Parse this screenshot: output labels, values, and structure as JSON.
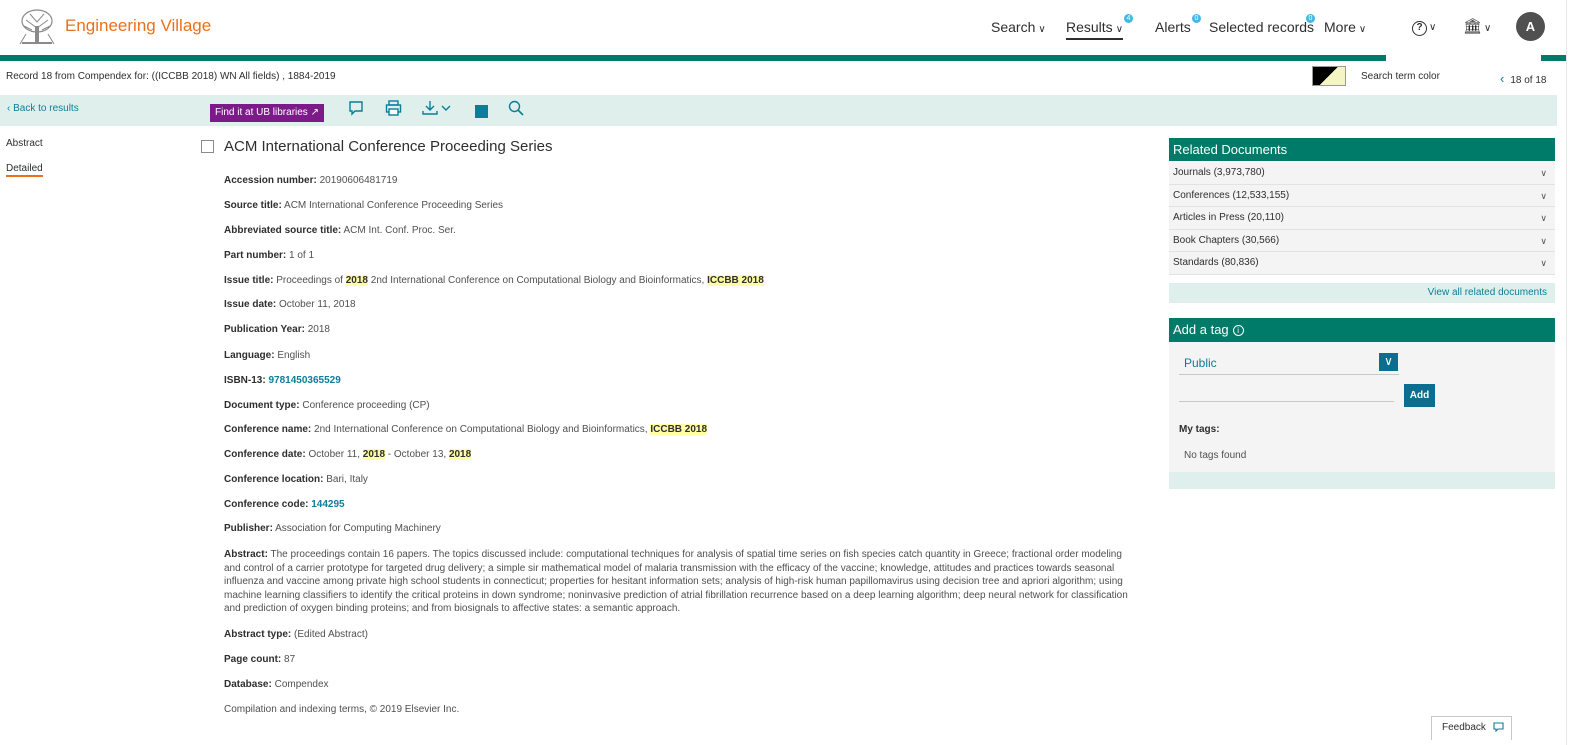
{
  "app": {
    "title": "Engineering Village"
  },
  "nav": {
    "search": "Search",
    "results": "Results",
    "results_badge": "4",
    "alerts": "Alerts",
    "alerts_badge": "0",
    "selected_records": "Selected records",
    "selected_badge": "0",
    "more": "More",
    "chevron": "∨",
    "help_icon": "?",
    "institution_icon": "🏛",
    "avatar": "A"
  },
  "subheader": {
    "record_info": "Record 18 from Compendex for: ((ICCBB 2018) WN All fields) , 1884-2019",
    "search_term_color": "Search term color",
    "pager": "18 of 18",
    "prev_icon": "‹"
  },
  "toolbar": {
    "back": "‹ Back to results",
    "find_it": "Find it at UB libraries ↗"
  },
  "leftnav": {
    "abstract": "Abstract",
    "detailed": "Detailed"
  },
  "doc": {
    "title": "ACM International Conference Proceeding Series",
    "accession_label": "Accession number:",
    "accession": "20190606481719",
    "source_label": "Source title:",
    "source": "ACM International Conference Proceeding Series",
    "abbrev_label": "Abbreviated source title:",
    "abbrev": "ACM Int. Conf. Proc. Ser.",
    "part_label": "Part number:",
    "part": "1 of 1",
    "issue_title_label": "Issue title:",
    "issue_title_pre": "Proceedings of",
    "issue_title_hl1": "2018",
    "issue_title_mid": "2nd International Conference on Computational Biology and Bioinformatics,",
    "issue_title_hl2": "ICCBB 2018",
    "issue_date_label": "Issue date:",
    "issue_date": "October 11, 2018",
    "pub_year_label": "Publication Year:",
    "pub_year": "2018",
    "language_label": "Language:",
    "language": "English",
    "isbn_label": "ISBN-13:",
    "isbn": "9781450365529",
    "doctype_label": "Document type:",
    "doctype": "Conference proceeding (CP)",
    "conf_name_label": "Conference name:",
    "conf_name": "2nd International Conference on Computational Biology and Bioinformatics,",
    "conf_name_hl": "ICCBB 2018",
    "conf_date_label": "Conference date:",
    "conf_date_1": "October 11,",
    "conf_date_hl1": "2018",
    "conf_date_2": "- October 13,",
    "conf_date_hl2": "2018",
    "conf_loc_label": "Conference location:",
    "conf_loc": "Bari, Italy",
    "conf_code_label": "Conference code:",
    "conf_code": "144295",
    "publisher_label": "Publisher:",
    "publisher": "Association for Computing Machinery",
    "abstract_label": "Abstract:",
    "abstract": "The proceedings contain 16 papers. The topics discussed include: computational techniques for analysis of spatial time series on fish species catch quantity in Greece; fractional order modeling and control of a carrier prototype for targeted drug delivery; a simple sir mathematical model of malaria transmission with the efficacy of the vaccine; knowledge, attitudes and practices towards seasonal influenza and vaccine among private high school students in connecticut; properties for hesitant information sets; analysis of high-risk human papillomavirus using decision tree and apriori algorithm; using machine learning classifiers to identify the critical proteins in down syndrome; noninvasive prediction of atrial fibrillation recurrence based on a deep learning algorithm; deep neural network for classification and prediction of oxygen binding proteins; and from biosignals to affective states: a semantic approach.",
    "abstract_type_label": "Abstract type:",
    "abstract_type": "(Edited Abstract)",
    "page_count_label": "Page count:",
    "page_count": "87",
    "database_label": "Database:",
    "database": "Compendex",
    "copyright": "Compilation and indexing terms, © 2019 Elsevier Inc."
  },
  "related": {
    "title": "Related Documents",
    "items": [
      {
        "label": "Journals (3,973,780)"
      },
      {
        "label": "Conferences (12,533,155)"
      },
      {
        "label": "Articles in Press (20,110)"
      },
      {
        "label": "Book Chapters (30,566)"
      },
      {
        "label": "Standards (80,836)"
      }
    ],
    "view_all": "View all related documents"
  },
  "tags": {
    "title": "Add a tag",
    "info_icon": "i",
    "visibility": "Public",
    "add": "Add",
    "my_tags": "My tags:",
    "none": "No tags found"
  },
  "feedback": {
    "label": "Feedback"
  },
  "colors": {
    "brand_orange": "#e9711c",
    "brand_green": "#007a69",
    "link_blue": "#0c7d99",
    "find_purple": "#7d1a8a",
    "highlight": "#ffffa8"
  }
}
